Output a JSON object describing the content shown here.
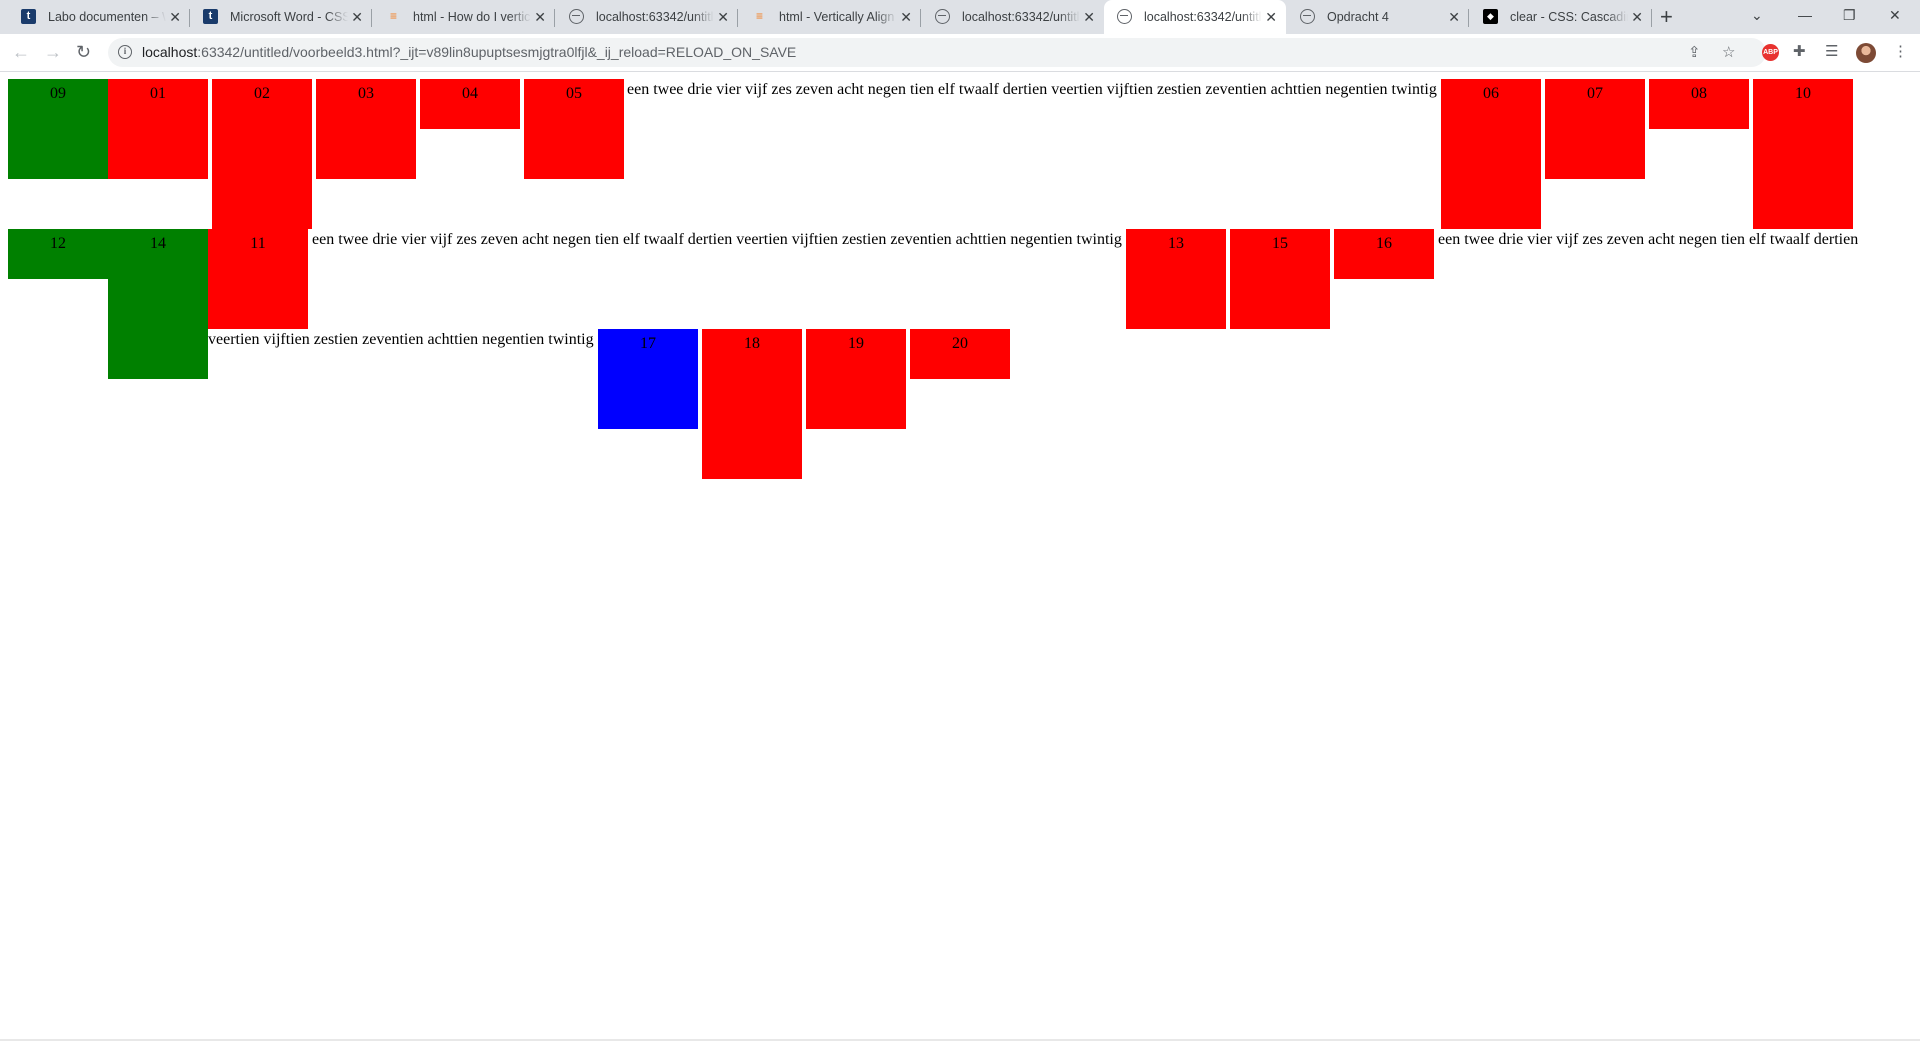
{
  "browser": {
    "tabs": [
      {
        "title": "Labo documenten – W",
        "favicon": "t-icon"
      },
      {
        "title": "Microsoft Word - CSS",
        "favicon": "t-icon"
      },
      {
        "title": "html - How do I vertica",
        "favicon": "stackoverflow-icon"
      },
      {
        "title": "localhost:63342/untitle",
        "favicon": "globe-icon"
      },
      {
        "title": "html - Vertically Align",
        "favicon": "stackoverflow-icon"
      },
      {
        "title": "localhost:63342/untitle",
        "favicon": "globe-icon"
      },
      {
        "title": "localhost:63342/untitle",
        "favicon": "globe-icon",
        "active": true
      },
      {
        "title": "Opdracht 4",
        "favicon": "globe-icon"
      },
      {
        "title": "clear - CSS: Cascading",
        "favicon": "mdn-icon"
      }
    ],
    "url_host": "localhost",
    "url_rest": ":63342/untitled/voorbeeld3.html?_ijt=v89lin8upuptsesmjgtra0lfjl&_ij_reload=RELOAD_ON_SAVE",
    "abp_label": "ABP"
  },
  "page": {
    "boxes": [
      {
        "label": "09",
        "color": "#008000"
      },
      {
        "label": "01",
        "color": "#ff0000"
      },
      {
        "label": "02",
        "color": "#ff0000"
      },
      {
        "label": "03",
        "color": "#ff0000"
      },
      {
        "label": "04",
        "color": "#ff0000"
      },
      {
        "label": "05",
        "color": "#ff0000"
      },
      {
        "label": "06",
        "color": "#ff0000"
      },
      {
        "label": "07",
        "color": "#ff0000"
      },
      {
        "label": "08",
        "color": "#ff0000"
      },
      {
        "label": "10",
        "color": "#ff0000"
      },
      {
        "label": "12",
        "color": "#008000"
      },
      {
        "label": "14",
        "color": "#008000"
      },
      {
        "label": "11",
        "color": "#ff0000"
      },
      {
        "label": "13",
        "color": "#ff0000"
      },
      {
        "label": "15",
        "color": "#ff0000"
      },
      {
        "label": "16",
        "color": "#ff0000"
      },
      {
        "label": "17",
        "color": "#0000ff"
      },
      {
        "label": "18",
        "color": "#ff0000"
      },
      {
        "label": "19",
        "color": "#ff0000"
      },
      {
        "label": "20",
        "color": "#ff0000"
      }
    ],
    "texts": [
      "een twee drie vier vijf zes zeven acht negen tien elf twaalf dertien veertien vijftien zestien zeventien achttien negentien twintig",
      "een twee drie vier vijf zes zeven acht negen tien elf twaalf dertien veertien vijftien zestien zeventien achttien negentien twintig",
      "een twee drie vier vijf zes zeven acht negen tien elf twaalf dertien",
      "veertien vijftien zestien zeventien achttien negentien twintig"
    ]
  }
}
